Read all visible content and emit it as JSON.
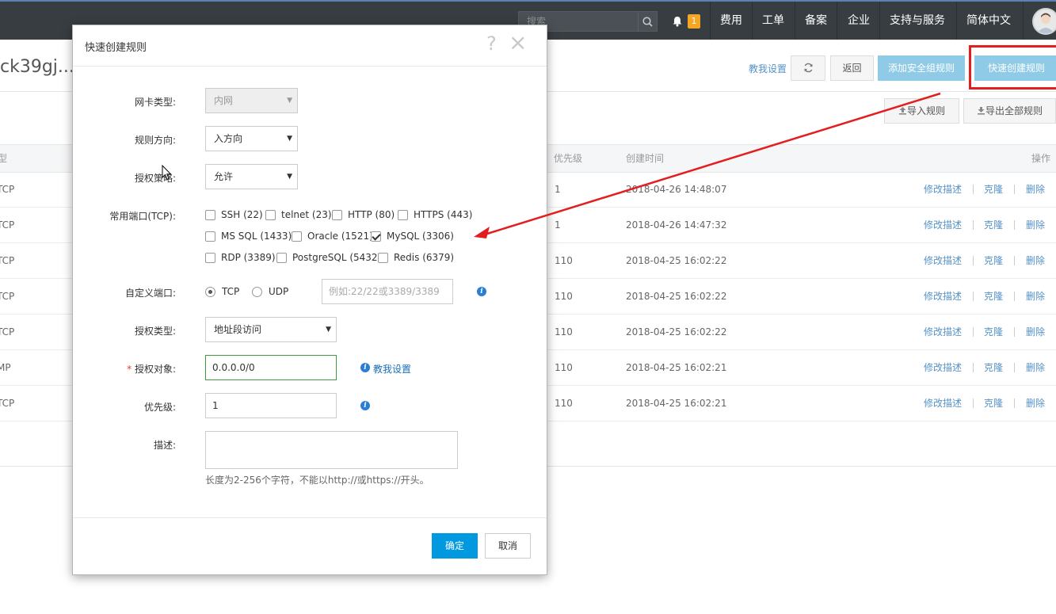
{
  "topnav": {
    "search_placeholder": "搜索",
    "notification_count": "1",
    "items": [
      "费用",
      "工单",
      "备案",
      "企业",
      "支持与服务",
      "简体中文"
    ]
  },
  "page": {
    "title_partial": "ck39gj...",
    "teach_link": "教我设置",
    "back_label": "返回",
    "add_rule_label": "添加安全组规则",
    "quick_create_label": "快速创建规则",
    "import_label": "导入规则",
    "export_label": "导出全部规则"
  },
  "table": {
    "headers": {
      "type": "型",
      "priority": "优先级",
      "created": "创建时间",
      "actions": "操作"
    },
    "rows": [
      {
        "type": "TCP",
        "priority": "1",
        "created": "2018-04-26 14:48:07"
      },
      {
        "type": "TCP",
        "priority": "1",
        "created": "2018-04-26 14:47:32"
      },
      {
        "type": "TCP",
        "priority": "110",
        "created": "2018-04-25 16:02:22"
      },
      {
        "type": "TCP",
        "priority": "110",
        "created": "2018-04-25 16:02:22"
      },
      {
        "type": "TCP",
        "priority": "110",
        "created": "2018-04-25 16:02:22"
      },
      {
        "type": "MP",
        "priority": "110",
        "created": "2018-04-25 16:02:21"
      },
      {
        "type": "TCP",
        "priority": "110",
        "created": "2018-04-25 16:02:21"
      }
    ],
    "action_labels": [
      "修改描述",
      "克隆",
      "删除"
    ]
  },
  "modal": {
    "title": "快速创建规则",
    "help_glyph": "?",
    "close_glyph": "×",
    "nic_type": {
      "label": "网卡类型:",
      "value": "内网"
    },
    "direction": {
      "label": "规则方向:",
      "value": "入方向"
    },
    "policy": {
      "label": "授权策略:",
      "value": "允许"
    },
    "common_ports": {
      "label": "常用端口(TCP):",
      "options": [
        {
          "label": "SSH (22)",
          "checked": false
        },
        {
          "label": "telnet (23)",
          "checked": false
        },
        {
          "label": "HTTP (80)",
          "checked": false
        },
        {
          "label": "HTTPS (443)",
          "checked": false
        },
        {
          "label": "MS SQL (1433)",
          "checked": false
        },
        {
          "label": "Oracle (1521)",
          "checked": false
        },
        {
          "label": "MySQL (3306)",
          "checked": true
        },
        {
          "label": "RDP (3389)",
          "checked": false
        },
        {
          "label": "PostgreSQL (5432)",
          "checked": false
        },
        {
          "label": "Redis (6379)",
          "checked": false
        }
      ]
    },
    "custom_port": {
      "label": "自定义端口:",
      "tcp": "TCP",
      "udp": "UDP",
      "placeholder": "例如:22/22或3389/3389"
    },
    "auth_type": {
      "label": "授权类型:",
      "value": "地址段访问"
    },
    "auth_object": {
      "required_mark": "*",
      "label": "授权对象:",
      "value": "0.0.0.0/0",
      "teach_link": "教我设置"
    },
    "priority": {
      "label": "优先级:",
      "value": "1"
    },
    "description": {
      "label": "描述:",
      "hint": "长度为2-256个字符，不能以http://或https://开头。"
    },
    "ok_label": "确定",
    "cancel_label": "取消"
  },
  "colors": {
    "primary": "#0099e0",
    "annotation_red": "#e31e1e",
    "nav_bg": "#373d41",
    "badge": "#f5a623"
  }
}
